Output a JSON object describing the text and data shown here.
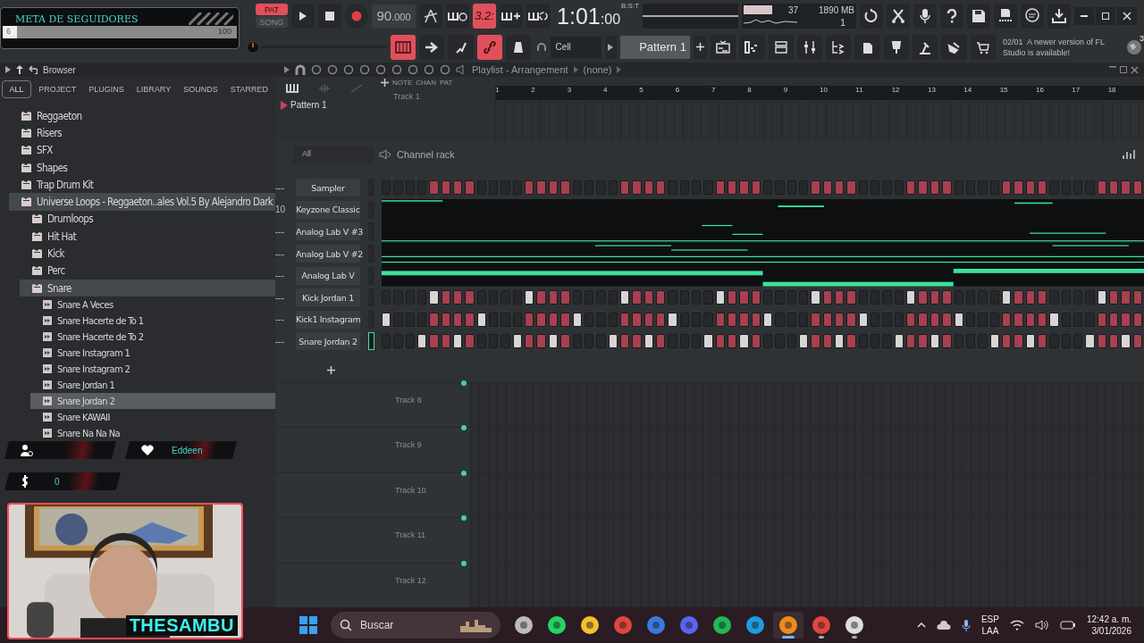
{
  "top_bar": {
    "modes": [
      {
        "label": "PAT",
        "selected": true
      },
      {
        "label": "SONG",
        "selected": false
      }
    ],
    "tempo_whole": "90",
    "tempo_fraction": ".000",
    "countdown": "3.2:",
    "time_main": "1:01",
    "time_sub": ":00",
    "time_label": "B:S:T",
    "cpu": "37",
    "memory": "1890 MB",
    "polyphony": "1",
    "tool_buttons": [
      {
        "kind": "keyboard",
        "on": true
      },
      {
        "kind": "arrow",
        "on": false
      },
      {
        "kind": "step",
        "on": false
      },
      {
        "kind": "link",
        "on": true
      },
      {
        "kind": "metronome",
        "on": false
      }
    ],
    "snap": "Cell",
    "pattern": "Pattern 1",
    "news": {
      "date": "02/01",
      "message": "A newer version of FL Studio is available!",
      "badge": "3"
    }
  },
  "browser": {
    "title": "Browser",
    "tabs": [
      {
        "label": "ALL",
        "selected": true
      },
      {
        "label": "PROJECT",
        "selected": false
      },
      {
        "label": "PLUGINS",
        "selected": false
      },
      {
        "label": "LIBRARY",
        "selected": false
      },
      {
        "label": "SOUNDS",
        "selected": false
      },
      {
        "label": "STARRED",
        "selected": false
      }
    ],
    "tree": [
      {
        "kind": "folder",
        "label": "Reggaeton",
        "expanded": false,
        "selected": false
      },
      {
        "kind": "folder",
        "label": "Risers",
        "expanded": false,
        "selected": false
      },
      {
        "kind": "folder",
        "label": "SFX",
        "expanded": false,
        "selected": false
      },
      {
        "kind": "folder",
        "label": "Shapes",
        "expanded": false,
        "selected": false
      },
      {
        "kind": "folder",
        "label": "Trap Drum Kit",
        "expanded": false,
        "selected": false
      },
      {
        "kind": "folder",
        "label": "Universe Loops - Reggaeton..ales Vol.5 By Alejandro Dark",
        "expanded": true,
        "selected": false,
        "children": [
          {
            "kind": "folder",
            "label": "Drumloops",
            "expanded": false,
            "selected": false
          },
          {
            "kind": "folder",
            "label": "Hit Hat",
            "expanded": false,
            "selected": false
          },
          {
            "kind": "folder",
            "label": "Kick",
            "expanded": false,
            "selected": false
          },
          {
            "kind": "folder",
            "label": "Perc",
            "expanded": false,
            "selected": false
          },
          {
            "kind": "folder",
            "label": "Snare",
            "expanded": true,
            "selected": false,
            "children": [
              {
                "kind": "file",
                "label": "Snare A Veces",
                "selected": false
              },
              {
                "kind": "file",
                "label": "Snare Hacerte de To 1",
                "selected": false
              },
              {
                "kind": "file",
                "label": "Snare Hacerte de To 2",
                "selected": false
              },
              {
                "kind": "file",
                "label": "Snare Instagram 1",
                "selected": false
              },
              {
                "kind": "file",
                "label": "Snare Instagram 2",
                "selected": false
              },
              {
                "kind": "file",
                "label": "Snare Jordan 1",
                "selected": false
              },
              {
                "kind": "file",
                "label": "Snare Jordan 2",
                "selected": true
              },
              {
                "kind": "file",
                "label": "Snare KAWAII",
                "selected": false
              },
              {
                "kind": "file",
                "label": "Snare Na Na Na",
                "selected": false
              }
            ]
          }
        ]
      }
    ]
  },
  "playlist": {
    "title": "Playlist - Arrangement",
    "target": "(none)",
    "picker_pattern": "Pattern 1",
    "tool_labels": [
      "NOTE",
      "CHAN",
      "PAT"
    ],
    "ruler": [
      "1",
      "2",
      "3",
      "4",
      "5",
      "6",
      "7",
      "8",
      "9",
      "10",
      "11",
      "12",
      "13",
      "14",
      "15",
      "16",
      "17",
      "18"
    ],
    "top_track": "Track 1",
    "lower_tracks": [
      "Track 8",
      "Track 9",
      "Track 10",
      "Track 11",
      "Track 12"
    ]
  },
  "channel_rack": {
    "title": "Channel rack",
    "filter": "All",
    "channels": [
      {
        "name": "Sampler",
        "mixer_track": "---",
        "kind": "steps",
        "selected": false,
        "steps": [
          false,
          false,
          false,
          false,
          true,
          true,
          true,
          true,
          false,
          false,
          false,
          false,
          true,
          true,
          true,
          true,
          false,
          false,
          false,
          false,
          true,
          true,
          true,
          true,
          false,
          false,
          false,
          false,
          true,
          true,
          true,
          true,
          false,
          false,
          false,
          false,
          true,
          true,
          true,
          true,
          false,
          false,
          false,
          false,
          true,
          true,
          true,
          true,
          false,
          false,
          false,
          false,
          true,
          true,
          true,
          true,
          false,
          false,
          false,
          false,
          true,
          true,
          true,
          true
        ]
      },
      {
        "name": "Keyzone Classic",
        "mixer_track": "10",
        "kind": "notes",
        "selected": false
      },
      {
        "name": "Analog Lab V #3",
        "mixer_track": "---",
        "kind": "notes",
        "selected": false
      },
      {
        "name": "Analog Lab V #2",
        "mixer_track": "---",
        "kind": "notes",
        "selected": false
      },
      {
        "name": "Analog Lab V",
        "mixer_track": "---",
        "kind": "notes",
        "selected": false
      },
      {
        "name": "Kick Jordan 1",
        "mixer_track": "---",
        "kind": "steps",
        "selected": false,
        "steps": [
          false,
          false,
          false,
          false,
          true,
          true,
          true,
          true,
          false,
          false,
          false,
          false,
          true,
          true,
          true,
          true,
          false,
          false,
          false,
          false,
          true,
          true,
          true,
          true,
          false,
          false,
          false,
          false,
          true,
          true,
          true,
          true,
          false,
          false,
          false,
          false,
          true,
          true,
          true,
          true,
          false,
          false,
          false,
          false,
          true,
          true,
          true,
          true,
          false,
          false,
          false,
          false,
          true,
          true,
          true,
          true,
          false,
          false,
          false,
          false,
          true,
          true,
          true,
          true
        ],
        "accents": [
          false,
          false,
          false,
          false,
          true,
          false,
          false,
          false,
          false,
          false,
          false,
          false,
          true,
          false,
          false,
          false,
          false,
          false,
          false,
          false,
          true,
          false,
          false,
          false,
          false,
          false,
          false,
          false,
          true,
          false,
          false,
          false,
          false,
          false,
          false,
          false,
          true,
          false,
          false,
          false,
          false,
          false,
          false,
          false,
          true,
          false,
          false,
          false,
          false,
          false,
          false,
          false,
          true,
          false,
          false,
          false,
          false,
          false,
          false,
          false,
          true,
          false,
          false,
          false
        ]
      },
      {
        "name": "Kick1 Instagram",
        "mixer_track": "---",
        "kind": "steps",
        "selected": false,
        "steps": [
          true,
          false,
          false,
          false,
          true,
          true,
          true,
          true,
          true,
          false,
          false,
          false,
          true,
          true,
          true,
          true,
          true,
          false,
          false,
          false,
          true,
          true,
          true,
          true,
          true,
          false,
          false,
          false,
          true,
          true,
          true,
          true,
          true,
          false,
          false,
          false,
          true,
          true,
          true,
          true,
          true,
          false,
          false,
          false,
          true,
          true,
          true,
          true,
          true,
          false,
          false,
          false,
          true,
          true,
          true,
          true,
          true,
          false,
          false,
          false,
          true,
          true,
          true,
          true
        ],
        "accents": [
          true,
          false,
          false,
          false,
          false,
          false,
          false,
          false,
          true,
          false,
          false,
          false,
          false,
          false,
          false,
          false,
          true,
          false,
          false,
          false,
          false,
          false,
          false,
          false,
          true,
          false,
          false,
          false,
          false,
          false,
          false,
          false,
          true,
          false,
          false,
          false,
          false,
          false,
          false,
          false,
          true,
          false,
          false,
          false,
          false,
          false,
          false,
          false,
          true,
          false,
          false,
          false,
          false,
          false,
          false,
          false,
          true,
          false,
          false,
          false,
          false,
          false,
          false,
          false
        ]
      },
      {
        "name": "Snare Jordan 2",
        "mixer_track": "---",
        "kind": "steps",
        "selected": true,
        "steps": [
          false,
          false,
          false,
          true,
          true,
          true,
          true,
          true,
          false,
          false,
          false,
          true,
          true,
          true,
          true,
          true,
          false,
          false,
          false,
          true,
          true,
          true,
          true,
          true,
          false,
          false,
          false,
          true,
          true,
          true,
          true,
          true,
          false,
          false,
          false,
          true,
          true,
          true,
          true,
          true,
          false,
          false,
          false,
          true,
          true,
          true,
          true,
          true,
          false,
          false,
          false,
          true,
          true,
          true,
          true,
          true,
          false,
          false,
          false,
          true,
          true,
          true,
          true,
          true
        ],
        "accents": [
          false,
          false,
          false,
          true,
          false,
          false,
          true,
          false,
          false,
          false,
          false,
          true,
          false,
          false,
          true,
          false,
          false,
          false,
          false,
          true,
          false,
          false,
          true,
          false,
          false,
          false,
          false,
          true,
          false,
          false,
          true,
          false,
          false,
          false,
          false,
          true,
          false,
          false,
          true,
          false,
          false,
          false,
          false,
          true,
          false,
          false,
          true,
          false,
          false,
          false,
          false,
          true,
          false,
          false,
          true,
          false,
          false,
          false,
          false,
          true,
          false,
          false,
          true,
          false
        ]
      }
    ]
  },
  "stream_overlay": {
    "goal_title": "META DE SEGUIDORES",
    "goal_current": "6",
    "goal_target": "100",
    "level": 0.06,
    "last_follower": "Eddeen",
    "donations": "0",
    "streamer": "THESAMBU"
  },
  "taskbar": {
    "search_placeholder": "Buscar",
    "language": "ESP",
    "layout": "LAA",
    "time": "12:42 a. m.",
    "date": "3/01/2026",
    "apps": [
      {
        "kind": "taskview",
        "running": false,
        "active": false
      },
      {
        "kind": "whatsapp",
        "running": false,
        "active": false
      },
      {
        "kind": "explorer",
        "running": false,
        "active": false
      },
      {
        "kind": "chrome",
        "running": false,
        "active": false
      },
      {
        "kind": "store",
        "running": false,
        "active": false
      },
      {
        "kind": "discord",
        "running": false,
        "active": false
      },
      {
        "kind": "spotify",
        "running": false,
        "active": false
      },
      {
        "kind": "edge",
        "running": false,
        "active": false
      },
      {
        "kind": "flstudio",
        "running": true,
        "active": true
      },
      {
        "kind": "chrome",
        "running": true,
        "active": false
      },
      {
        "kind": "obs",
        "running": true,
        "active": false
      }
    ]
  }
}
